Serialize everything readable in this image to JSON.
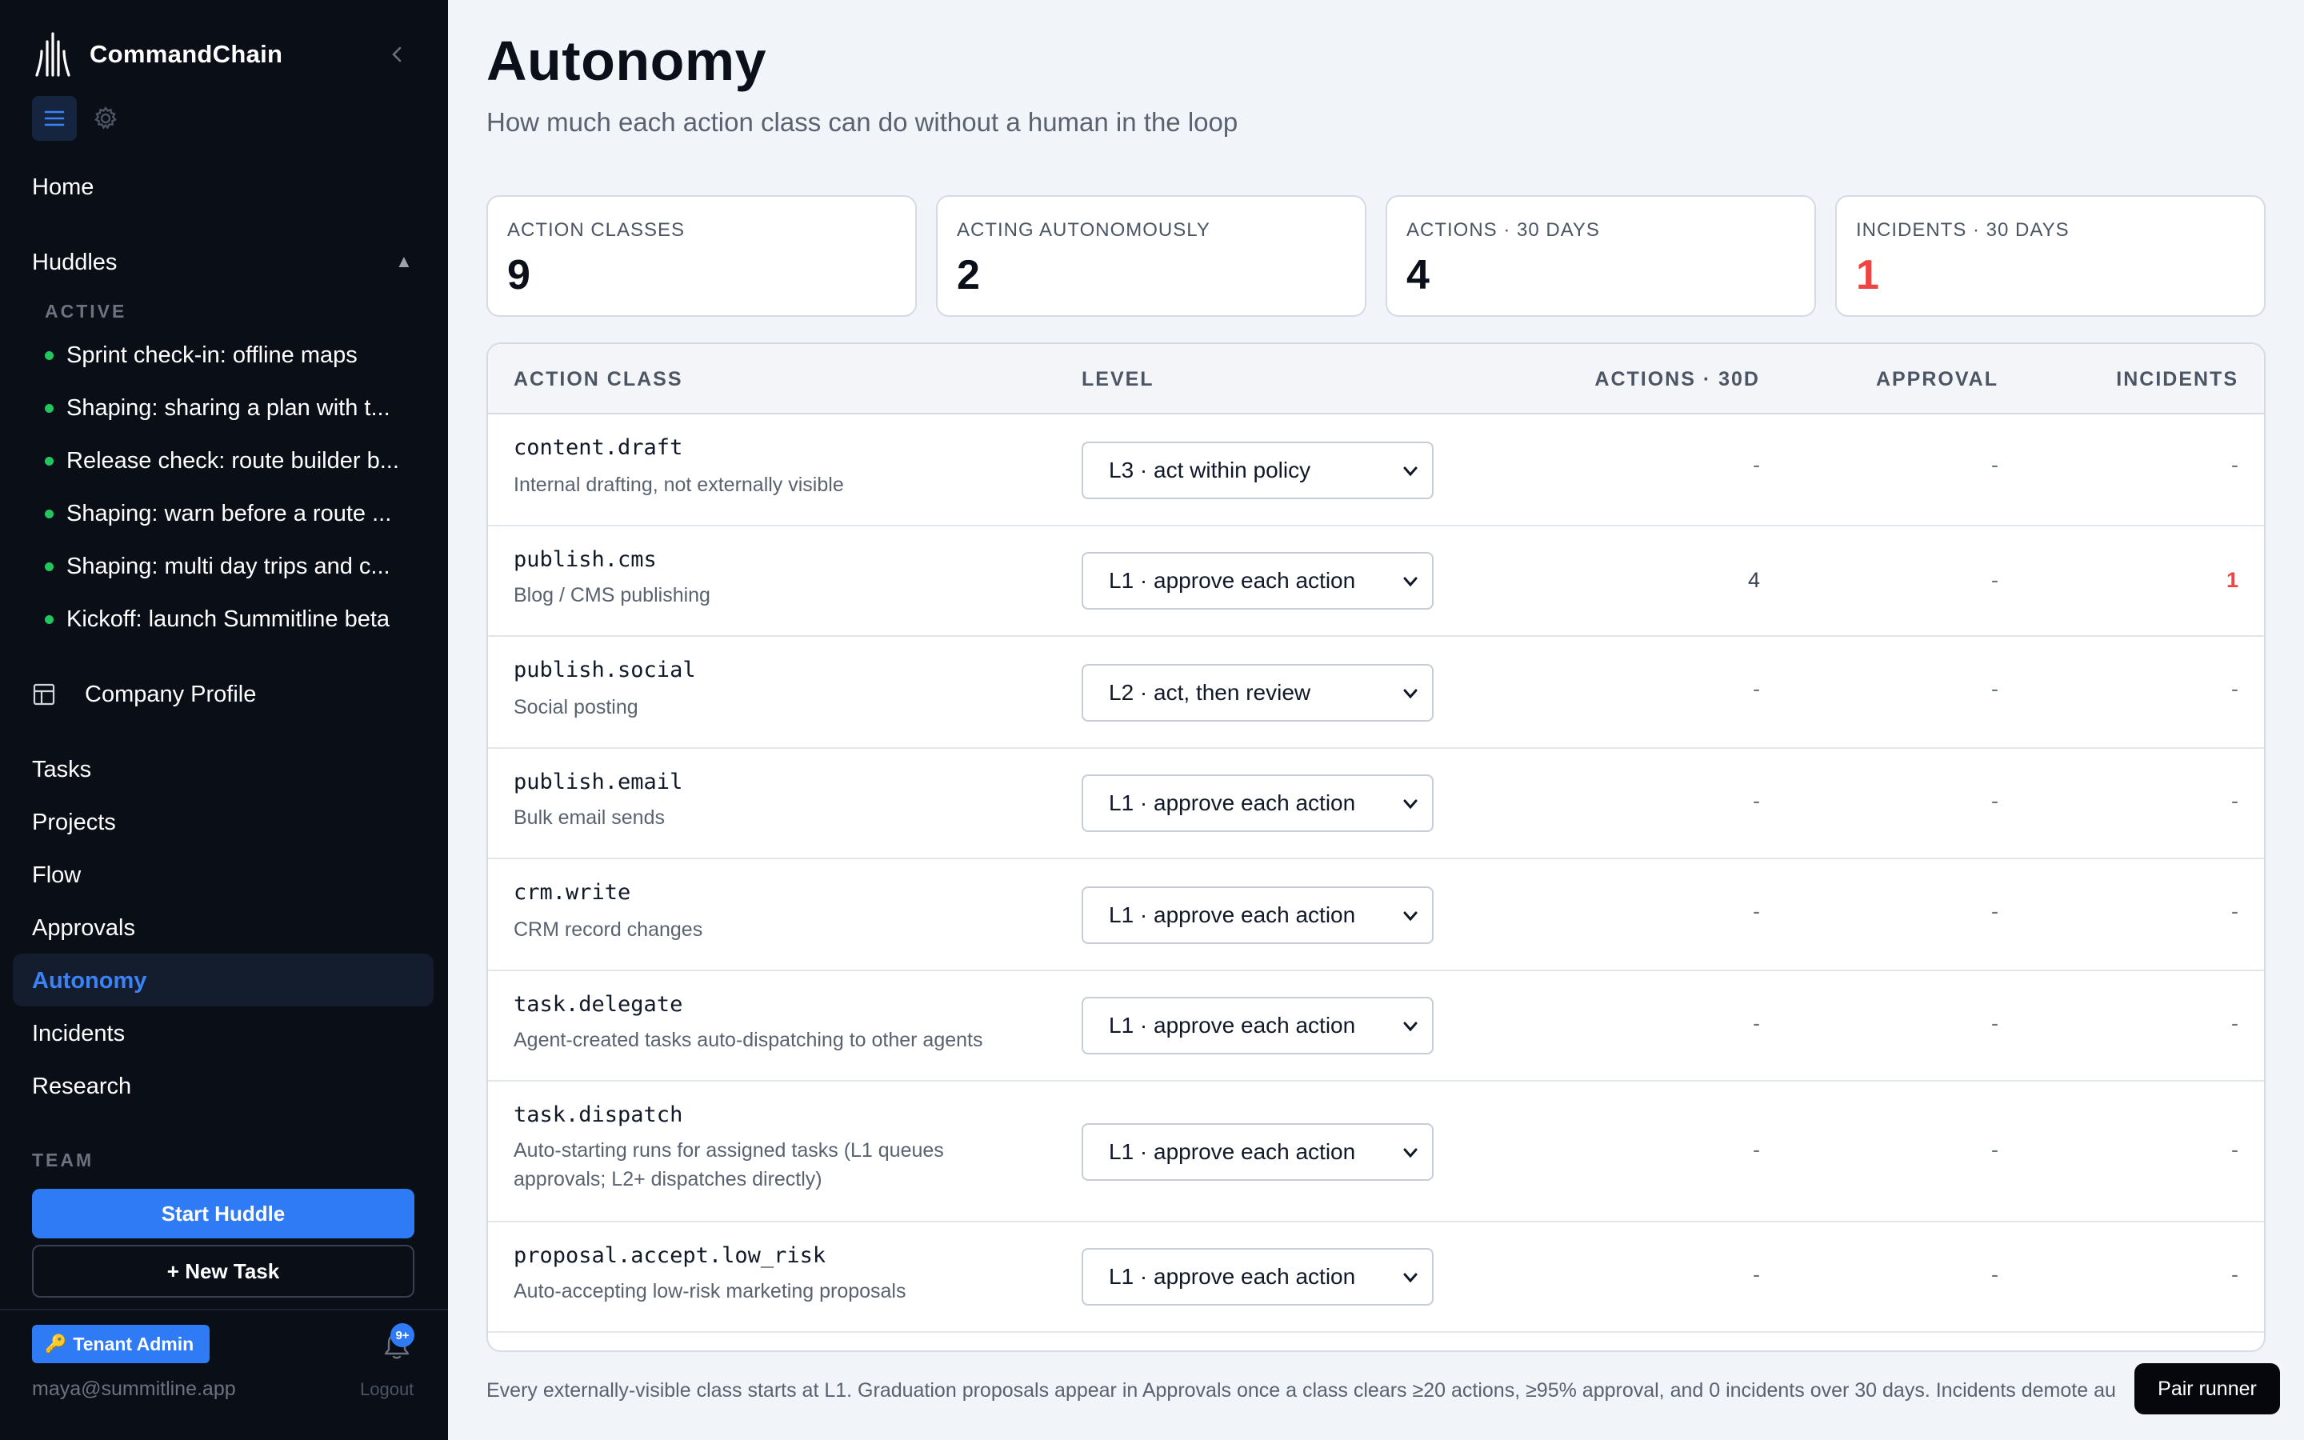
{
  "app": {
    "name": "CommandChain",
    "colors": {
      "accent": "#2f7bf6",
      "sidebar_bg": "#0a0e17",
      "danger": "#ef4444",
      "active_dot": "#22c55e"
    }
  },
  "sidebar": {
    "collapse_icon": "chevron-left-icon",
    "tools": [
      {
        "icon": "menu-icon",
        "active": true
      },
      {
        "icon": "gear-icon",
        "active": false
      }
    ],
    "home": "Home",
    "huddles": {
      "label": "Huddles",
      "toggle": "▲",
      "active_label": "ACTIVE",
      "items": [
        "Sprint check-in: offline maps",
        "Shaping: sharing a plan with t...",
        "Release check: route builder b...",
        "Shaping: warn before a route ...",
        "Shaping: multi day trips and c...",
        "Kickoff: launch Summitline beta"
      ]
    },
    "company_profile": "Company Profile",
    "nav": [
      "Tasks",
      "Projects",
      "Flow",
      "Approvals",
      "Autonomy",
      "Incidents",
      "Research"
    ],
    "active_nav": "Autonomy",
    "team_label": "TEAM",
    "start_huddle": "Start Huddle",
    "new_task": "+ New Task",
    "role_badge": "Tenant Admin",
    "role_icon": "🔑",
    "notifications": "9+",
    "user_email": "maya@summitline.app",
    "logout": "Logout"
  },
  "main": {
    "title": "Autonomy",
    "subtitle": "How much each action class can do without a human in the loop",
    "stats": [
      {
        "label": "ACTION CLASSES",
        "value": "9"
      },
      {
        "label": "ACTING AUTONOMOUSLY",
        "value": "2"
      },
      {
        "label": "ACTIONS · 30 DAYS",
        "value": "4"
      },
      {
        "label": "INCIDENTS · 30 DAYS",
        "value": "1"
      }
    ],
    "table": {
      "headers": {
        "action_class": "ACTION CLASS",
        "level": "LEVEL",
        "actions": "ACTIONS · 30D",
        "approval": "APPROVAL",
        "incidents": "INCIDENTS"
      },
      "rows": [
        {
          "code": "content.draft",
          "desc": "Internal drafting, not externally visible",
          "level": "L3 · act within policy",
          "actions": "-",
          "approval": "-",
          "incidents": "-"
        },
        {
          "code": "publish.cms",
          "desc": "Blog / CMS publishing",
          "level": "L1 · approve each action",
          "actions": "4",
          "approval": "-",
          "incidents": "1"
        },
        {
          "code": "publish.social",
          "desc": "Social posting",
          "level": "L2 · act, then review",
          "actions": "-",
          "approval": "-",
          "incidents": "-"
        },
        {
          "code": "publish.email",
          "desc": "Bulk email sends",
          "level": "L1 · approve each action",
          "actions": "-",
          "approval": "-",
          "incidents": "-"
        },
        {
          "code": "crm.write",
          "desc": "CRM record changes",
          "level": "L1 · approve each action",
          "actions": "-",
          "approval": "-",
          "incidents": "-"
        },
        {
          "code": "task.delegate",
          "desc": "Agent-created tasks auto-dispatching to other agents",
          "level": "L1 · approve each action",
          "actions": "-",
          "approval": "-",
          "incidents": "-"
        },
        {
          "code": "task.dispatch",
          "desc": "Auto-starting runs for assigned tasks (L1 queues approvals; L2+ dispatches directly)",
          "level": "L1 · approve each action",
          "actions": "-",
          "approval": "-",
          "incidents": "-"
        },
        {
          "code": "proposal.accept.low_risk",
          "desc": "Auto-accepting low-risk marketing proposals",
          "level": "L1 · approve each action",
          "actions": "-",
          "approval": "-",
          "incidents": "-"
        }
      ]
    },
    "footer_note": "Every externally-visible class starts at L1. Graduation proposals appear in Approvals once a class clears ≥20 actions, ≥95% approval, and 0 incidents over 30 days. Incidents demote au"
  },
  "pair_runner": "Pair runner"
}
